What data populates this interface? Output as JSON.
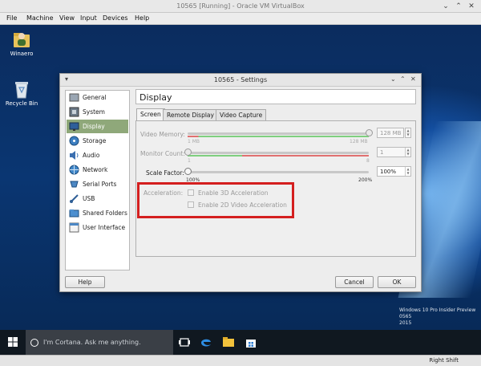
{
  "host_window": {
    "title": "10565 [Running] - Oracle VM VirtualBox",
    "controls": {
      "minimize": "⌄",
      "maximize": "⌃",
      "close": "✕"
    }
  },
  "host_menu": [
    "File",
    "Machine",
    "View",
    "Input",
    "Devices",
    "Help"
  ],
  "desktop": {
    "icons": [
      {
        "label": "Winaero",
        "icon": "user-folder-icon"
      },
      {
        "label": "Recycle Bin",
        "icon": "recycle-bin-icon"
      }
    ],
    "watermark_lines": [
      "Windows 10 Pro Insider Preview",
      "0565",
      "2015"
    ]
  },
  "taskbar": {
    "search_placeholder": "I'm Cortana. Ask me anything."
  },
  "host_status": {
    "host_key": "Right Shift"
  },
  "settings": {
    "title": "10565 - Settings",
    "sidebar": [
      {
        "label": "General",
        "icon": "general-icon",
        "active": false
      },
      {
        "label": "System",
        "icon": "system-icon",
        "active": false
      },
      {
        "label": "Display",
        "icon": "display-icon",
        "active": true
      },
      {
        "label": "Storage",
        "icon": "storage-icon",
        "active": false
      },
      {
        "label": "Audio",
        "icon": "audio-icon",
        "active": false
      },
      {
        "label": "Network",
        "icon": "network-icon",
        "active": false
      },
      {
        "label": "Serial Ports",
        "icon": "serial-ports-icon",
        "active": false
      },
      {
        "label": "USB",
        "icon": "usb-icon",
        "active": false
      },
      {
        "label": "Shared Folders",
        "icon": "shared-folders-icon",
        "active": false
      },
      {
        "label": "User Interface",
        "icon": "user-interface-icon",
        "active": false
      }
    ],
    "panel_title": "Display",
    "tabs": [
      {
        "label": "Screen",
        "active": true
      },
      {
        "label": "Remote Display",
        "active": false
      },
      {
        "label": "Video Capture",
        "active": false
      }
    ],
    "screen": {
      "video_memory": {
        "label": "Video Memory:",
        "value": "128 MB",
        "min": "1 MB",
        "max": "128 MB",
        "fraction": 1.0
      },
      "monitor_count": {
        "label": "Monitor Count:",
        "value": "1",
        "min": "1",
        "max": "8",
        "fraction": 0.0
      },
      "scale_factor": {
        "label": "Scale Factor:",
        "value": "100%",
        "min": "100%",
        "max": "200%",
        "fraction": 0.0
      },
      "acceleration": {
        "label": "Acceleration:",
        "enable_3d": "Enable 3D Acceleration",
        "enable_2d": "Enable 2D Video Acceleration"
      }
    },
    "buttons": {
      "help": "Help",
      "cancel": "Cancel",
      "ok": "OK"
    }
  }
}
